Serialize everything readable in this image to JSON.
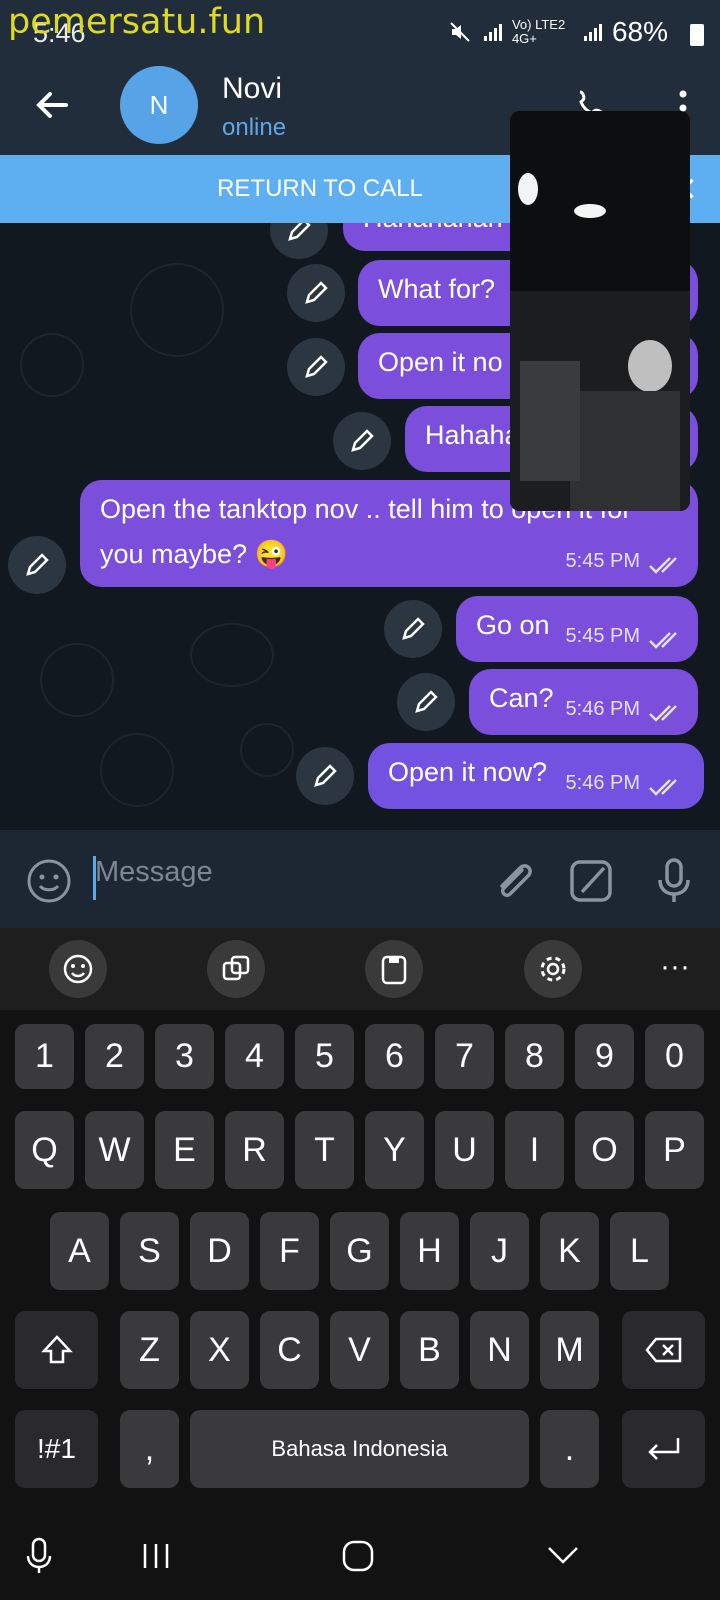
{
  "watermark": "pemersatu.fun",
  "status_bar": {
    "time": "5:46",
    "battery": "68%",
    "network": "Vo) LTE2 4G+"
  },
  "header": {
    "avatar_letter": "N",
    "contact_name": "Novi",
    "contact_status": "online"
  },
  "return_to_call": {
    "label": "RETURN TO CALL"
  },
  "messages": [
    {
      "text": "Hahahahah",
      "time": ""
    },
    {
      "text": "What for?",
      "time": ""
    },
    {
      "text": "Open it no",
      "time": ""
    },
    {
      "text": "Hahaha",
      "time": ""
    },
    {
      "text": "Open the tanktop nov .. tell him to open it for",
      "text2": "you maybe? 😜",
      "time": "5:45 PM"
    },
    {
      "text": "Go on",
      "time": "5:45 PM"
    },
    {
      "text": "Can?",
      "time": "5:46 PM"
    },
    {
      "text": "Open it now?",
      "time": "5:46 PM"
    }
  ],
  "composer": {
    "placeholder": "Message"
  },
  "keyboard": {
    "row_numbers": [
      "1",
      "2",
      "3",
      "4",
      "5",
      "6",
      "7",
      "8",
      "9",
      "0"
    ],
    "row_1": [
      "Q",
      "W",
      "E",
      "R",
      "T",
      "Y",
      "U",
      "I",
      "O",
      "P"
    ],
    "row_2": [
      "A",
      "S",
      "D",
      "F",
      "G",
      "H",
      "J",
      "K",
      "L"
    ],
    "row_3": [
      "Z",
      "X",
      "C",
      "V",
      "B",
      "N",
      "M"
    ],
    "symbols_key": "!#1",
    "comma_key": ",",
    "space_label": "Bahasa Indonesia",
    "period_key": "."
  },
  "colors": {
    "bubble": "#7b4fdc",
    "accent": "#5eaff1",
    "header": "#222d3b"
  }
}
